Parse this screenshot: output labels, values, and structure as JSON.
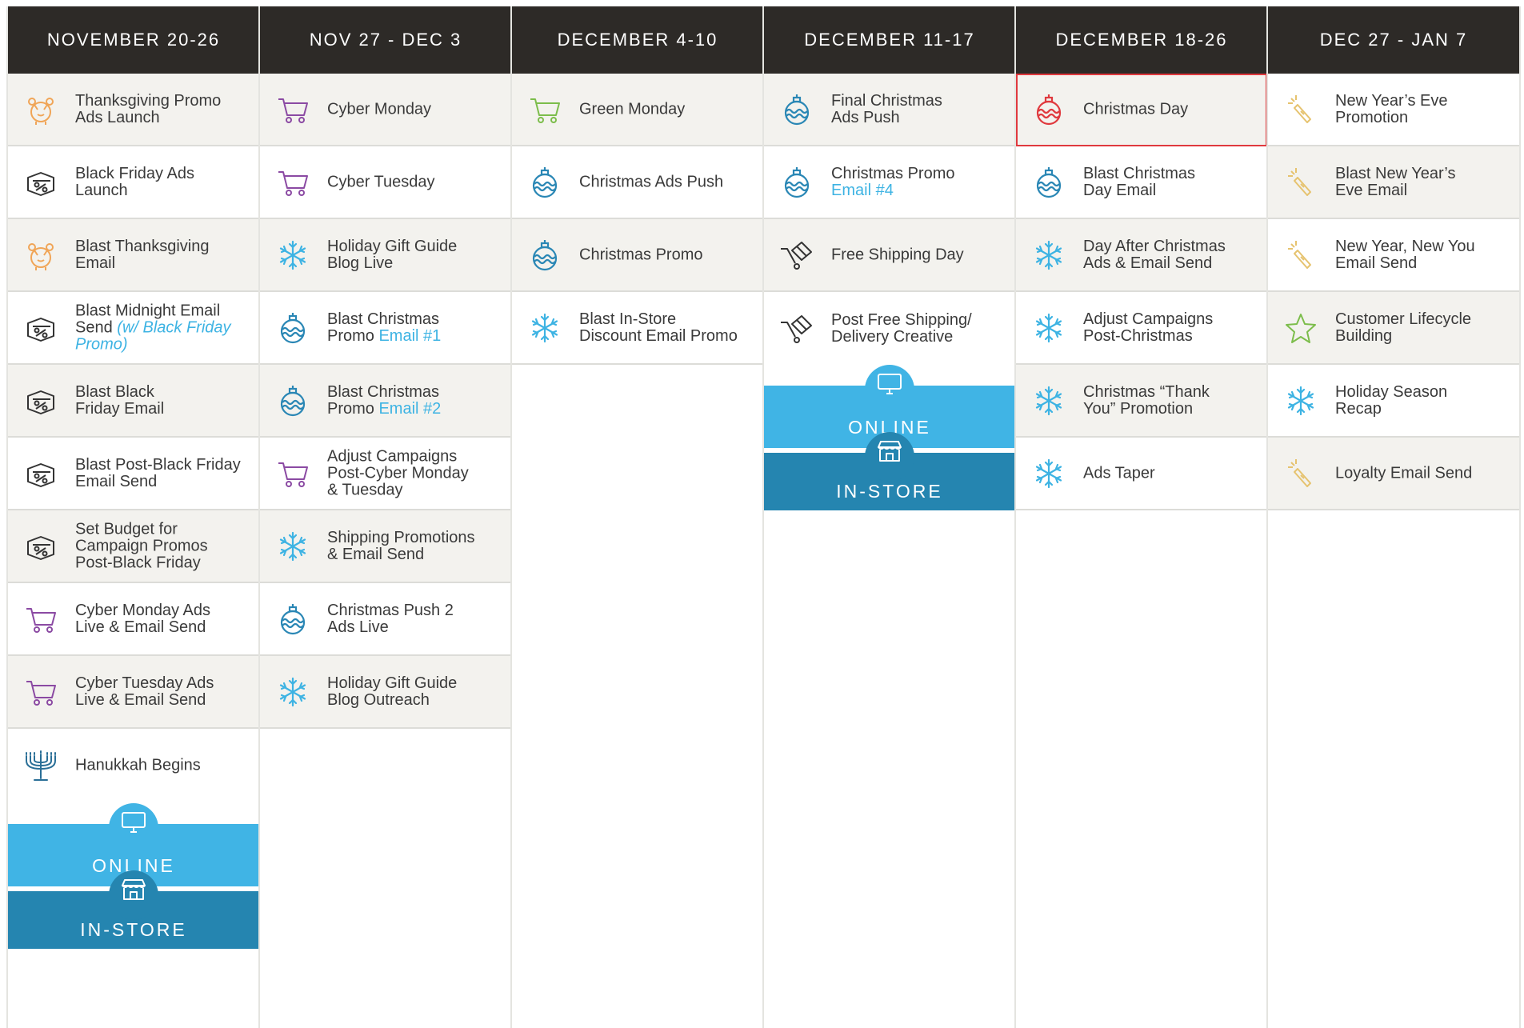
{
  "colors": {
    "header_bg": "#2d2a27",
    "shade_row": "#f3f2ee",
    "online_band": "#40b4e5",
    "instore_band": "#2585b0",
    "highlight_border": "#e0393e",
    "email_highlight": "#3db3e3",
    "cart_purple": "#8b4aa3",
    "cart_green": "#7cbd4b",
    "turkey_orange": "#f0a557",
    "snowflake_blue": "#3db3e3",
    "ornament_blue": "#2a87b5",
    "ornament_red": "#e0393e",
    "champagne_gold": "#e6c36f",
    "star_green": "#7cbd4b"
  },
  "bands": {
    "online_label": "ONLINE",
    "instore_label": "IN-STORE"
  },
  "columns": [
    {
      "header": "NOVEMBER 20-26",
      "items": [
        {
          "icon": "turkey-icon",
          "lines": [
            "Thanksgiving Promo",
            "Ads Launch"
          ]
        },
        {
          "icon": "discount-tag-icon",
          "lines": [
            "Black Friday Ads",
            "Launch"
          ]
        },
        {
          "icon": "turkey-icon",
          "lines": [
            "Blast Thanksgiving",
            "Email"
          ]
        },
        {
          "icon": "discount-tag-icon",
          "lines": [
            "Blast Midnight Email",
            "Send"
          ],
          "note": "(w/ Black Friday Promo)"
        },
        {
          "icon": "discount-tag-icon",
          "lines": [
            "Blast Black",
            "Friday Email"
          ]
        },
        {
          "icon": "discount-tag-icon",
          "lines": [
            "Blast Post-Black Friday",
            "Email Send"
          ]
        },
        {
          "icon": "discount-tag-icon",
          "lines": [
            "Set Budget for",
            "Campaign Promos",
            "Post-Black Friday"
          ]
        },
        {
          "icon": "cart-purple-icon",
          "lines": [
            "Cyber Monday Ads",
            "Live & Email Send"
          ]
        },
        {
          "icon": "cart-purple-icon",
          "lines": [
            "Cyber Tuesday Ads",
            "Live & Email Send"
          ]
        },
        {
          "icon": "menorah-icon",
          "lines": [
            "Hanukkah Begins"
          ]
        }
      ]
    },
    {
      "header": "NOV 27 - DEC 3",
      "items": [
        {
          "icon": "cart-purple-icon",
          "lines": [
            "Cyber Monday"
          ]
        },
        {
          "icon": "cart-purple-icon",
          "lines": [
            "Cyber Tuesday"
          ]
        },
        {
          "icon": "snowflake-icon",
          "lines": [
            "Holiday Gift Guide",
            "Blog Live"
          ]
        },
        {
          "icon": "ornament-icon",
          "lines": [
            "Blast Christmas",
            "Promo"
          ],
          "email": "Email #1"
        },
        {
          "icon": "ornament-icon",
          "lines": [
            "Blast Christmas",
            "Promo"
          ],
          "email": "Email #2"
        },
        {
          "icon": "cart-purple-icon",
          "lines": [
            "Adjust Campaigns",
            "Post-Cyber Monday",
            "& Tuesday"
          ]
        },
        {
          "icon": "snowflake-icon",
          "lines": [
            "Shipping Promotions",
            "& Email Send"
          ]
        },
        {
          "icon": "ornament-icon",
          "lines": [
            "Christmas Push 2",
            "Ads Live"
          ]
        },
        {
          "icon": "snowflake-icon",
          "lines": [
            "Holiday Gift Guide",
            "Blog Outreach"
          ]
        }
      ]
    },
    {
      "header": "DECEMBER 4-10",
      "items": [
        {
          "icon": "cart-green-icon",
          "lines": [
            "Green Monday"
          ]
        },
        {
          "icon": "ornament-icon",
          "lines": [
            "Christmas Ads Push"
          ]
        },
        {
          "icon": "ornament-icon",
          "lines": [
            "Christmas Promo"
          ]
        },
        {
          "icon": "snowflake-icon",
          "lines": [
            "Blast In-Store",
            "Discount Email Promo"
          ]
        }
      ]
    },
    {
      "header": "DECEMBER 11-17",
      "items": [
        {
          "icon": "ornament-icon",
          "lines": [
            "Final Christmas",
            "Ads Push"
          ]
        },
        {
          "icon": "ornament-icon",
          "lines": [
            "Christmas Promo"
          ],
          "email": "Email #4"
        },
        {
          "icon": "shipping-box-icon",
          "lines": [
            "Free Shipping Day"
          ]
        },
        {
          "icon": "shipping-box-icon",
          "lines": [
            "Post Free Shipping/",
            "Delivery Creative"
          ]
        }
      ]
    },
    {
      "header": "DECEMBER 18-26",
      "items": [
        {
          "icon": "ornament-red-icon",
          "lines": [
            "Christmas Day"
          ]
        },
        {
          "icon": "ornament-icon",
          "lines": [
            "Blast Christmas",
            "Day Email"
          ]
        },
        {
          "icon": "snowflake-icon",
          "lines": [
            "Day After Christmas",
            "Ads & Email Send"
          ]
        },
        {
          "icon": "snowflake-icon",
          "lines": [
            "Adjust Campaigns",
            "Post-Christmas"
          ]
        },
        {
          "icon": "snowflake-icon",
          "lines": [
            "Christmas “Thank",
            "You” Promotion"
          ]
        },
        {
          "icon": "snowflake-icon",
          "lines": [
            "Ads Taper"
          ]
        }
      ]
    },
    {
      "header": "DEC 27 - JAN 7",
      "items": [
        {
          "icon": "champagne-icon",
          "lines": [
            "New Year’s Eve",
            "Promotion"
          ]
        },
        {
          "icon": "champagne-icon",
          "lines": [
            "Blast New Year’s",
            "Eve Email"
          ]
        },
        {
          "icon": "champagne-icon",
          "lines": [
            "New Year, New You",
            "Email Send"
          ]
        },
        {
          "icon": "star-icon",
          "lines": [
            "Customer Lifecycle",
            "Building"
          ]
        },
        {
          "icon": "snowflake-icon",
          "lines": [
            "Holiday Season",
            "Recap"
          ]
        },
        {
          "icon": "champagne-icon",
          "lines": [
            "Loyalty Email Send"
          ]
        }
      ]
    }
  ]
}
